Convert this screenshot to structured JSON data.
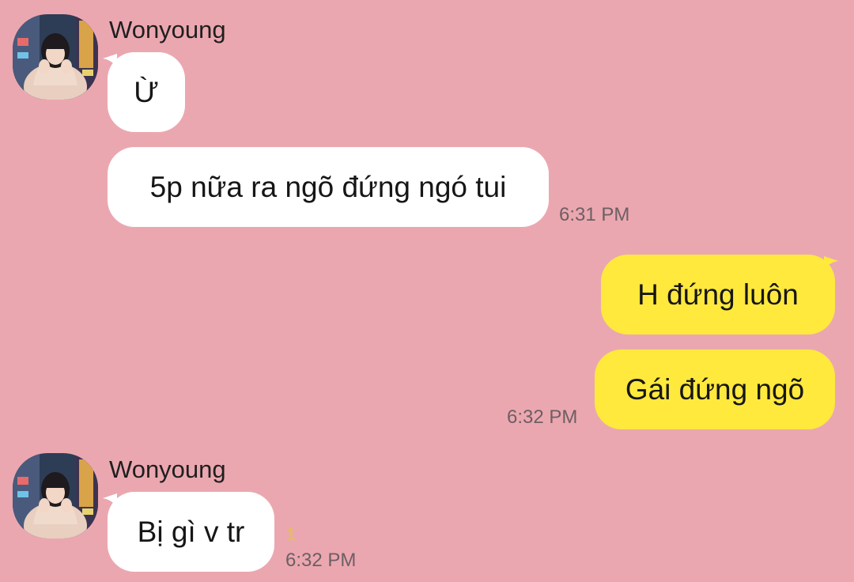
{
  "colors": {
    "background": "#eba7b0",
    "incoming_bubble": "#ffffff",
    "outgoing_bubble": "#ffe93d",
    "timestamp": "#6c5f63",
    "unread_count": "#e3c53a"
  },
  "messages": {
    "group1": {
      "sender": "Wonyoung",
      "msg1": "Ừ",
      "msg2": "5p nữa ra ngõ đứng ngó tui",
      "time": "6:31 PM"
    },
    "outgoing": {
      "msg1": "H đứng luôn",
      "msg2": "Gái đứng ngõ",
      "time": "6:32 PM"
    },
    "group2": {
      "sender": "Wonyoung",
      "msg1": "Bị gì v tr",
      "unread": "1",
      "time": "6:32 PM"
    }
  }
}
